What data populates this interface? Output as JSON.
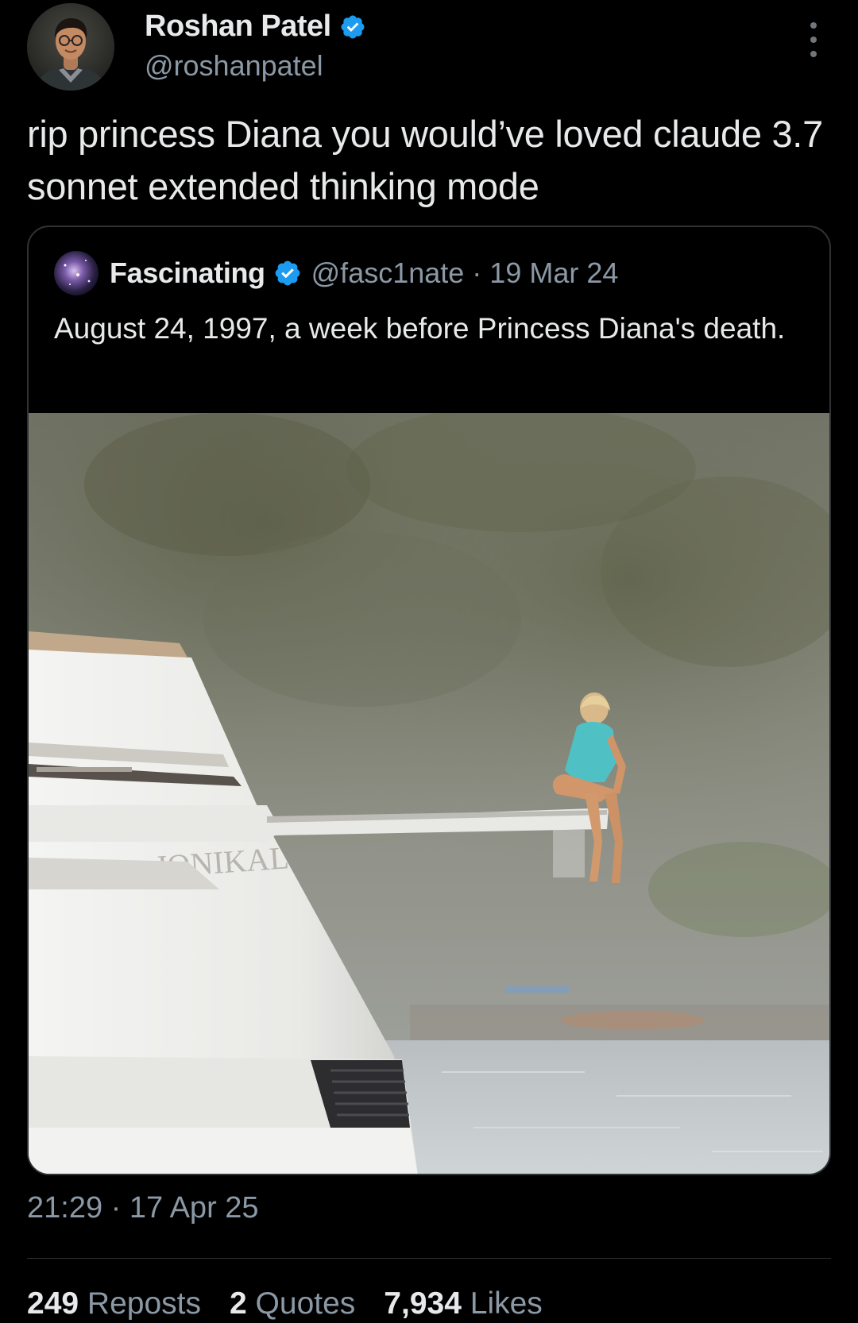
{
  "author": {
    "name": "Roshan Patel",
    "handle": "@roshanpatel",
    "verified": true
  },
  "tweet": {
    "text": "rip princess Diana you would’ve loved claude 3.7 sonnet extended thinking mode",
    "timestamp": "21:29 · 17 Apr 25"
  },
  "quoted": {
    "name": "Fascinating",
    "handle": "@fasc1nate",
    "separator": "·",
    "date": "19 Mar 24",
    "verified": true,
    "text": "August 24, 1997, a week before Princess Diana's death.",
    "yacht_lettering": "JONIKAL"
  },
  "stats": {
    "reposts_count": "249",
    "reposts_label": "Reposts",
    "quotes_count": "2",
    "quotes_label": "Quotes",
    "likes_count": "7,934",
    "likes_label": "Likes"
  },
  "colors": {
    "background": "#000000",
    "text_primary": "#e7e9ea",
    "text_secondary": "#8b98a5",
    "border": "#2f3336",
    "verified_blue": "#1d9bf0"
  },
  "icons": [
    "verified-badge-icon",
    "more-options-icon"
  ]
}
